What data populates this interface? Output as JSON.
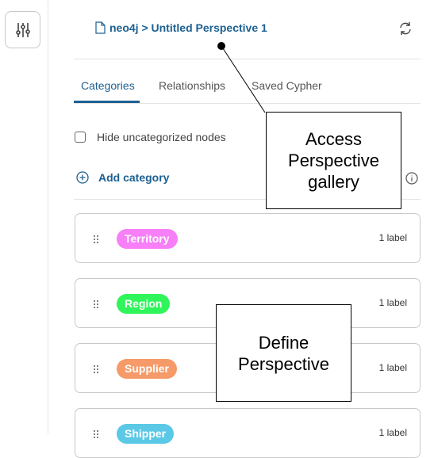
{
  "sidebar": {
    "settings_icon": "sliders-icon"
  },
  "header": {
    "breadcrumb": "neo4j > Untitled Perspective 1",
    "file_icon": "file-icon",
    "refresh_icon": "refresh-icon"
  },
  "tabs": [
    {
      "label": "Categories",
      "active": true
    },
    {
      "label": "Relationships"
    },
    {
      "label": "Saved Cypher"
    }
  ],
  "options": {
    "hide_uncategorized": "Hide uncategorized nodes",
    "hide_checked": false,
    "add_category": "Add category"
  },
  "categories": [
    {
      "name": "Territory",
      "color": "#f77ff7",
      "count": "1 label"
    },
    {
      "name": "Region",
      "color": "#2ff55a",
      "count": "1 label"
    },
    {
      "name": "Supplier",
      "color": "#f59a68",
      "count": "1 label"
    },
    {
      "name": "Shipper",
      "color": "#5bc8e6",
      "count": "1 label"
    }
  ],
  "annotations": {
    "gallery": "Access Perspective gallery",
    "define": "Define Perspective"
  },
  "accent": "#1d6091"
}
